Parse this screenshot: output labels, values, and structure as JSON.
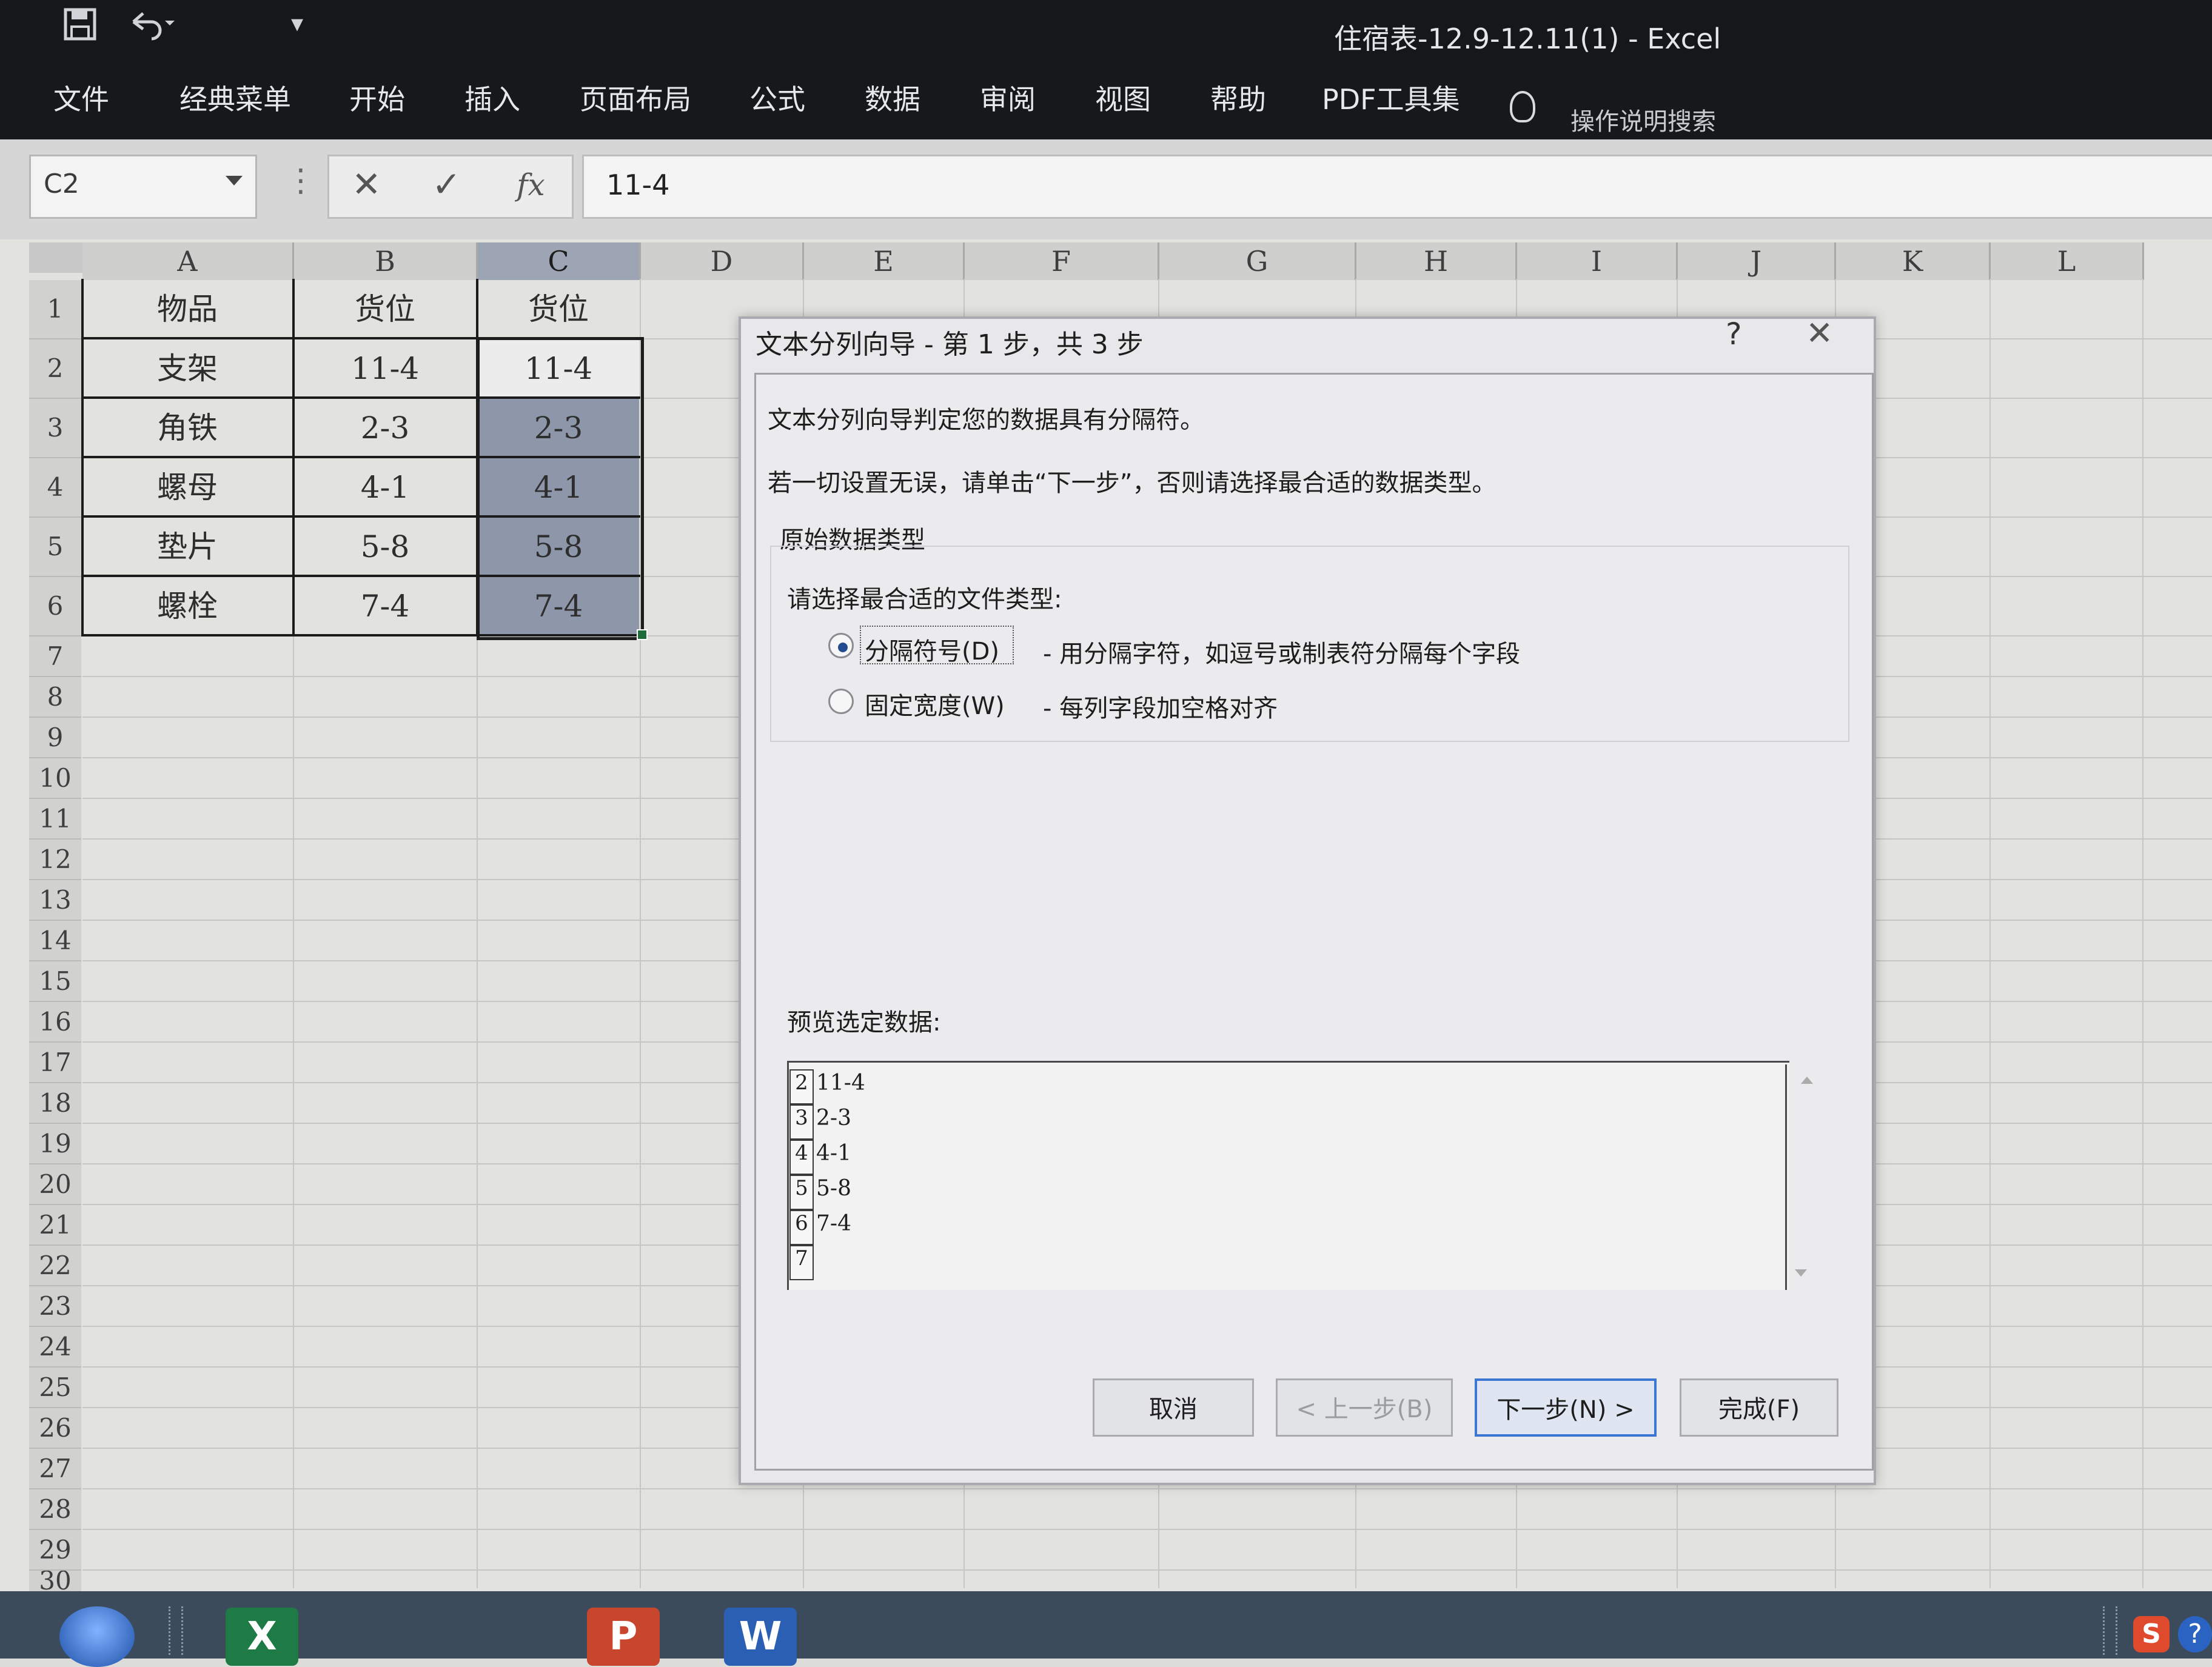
{
  "window": {
    "title": "住宿表-12.9-12.11(1)  -  Excel"
  },
  "ribbon": {
    "tabs": [
      "文件",
      "经典菜单",
      "开始",
      "插入",
      "页面布局",
      "公式",
      "数据",
      "审阅",
      "视图",
      "帮助",
      "PDF工具集"
    ],
    "tell_me": "操作说明搜索"
  },
  "formula_bar": {
    "name_box": "C2",
    "cancel_icon": "✕",
    "enter_icon": "✓",
    "fx_label": "fx",
    "formula": "11-4"
  },
  "sheet": {
    "columns": [
      "A",
      "B",
      "C",
      "D",
      "E",
      "F",
      "G",
      "H",
      "I",
      "J",
      "K",
      "L"
    ],
    "rows": [
      "1",
      "2",
      "3",
      "4",
      "5",
      "6",
      "7",
      "8",
      "9",
      "10",
      "11",
      "12",
      "13",
      "14",
      "15",
      "16",
      "17",
      "18",
      "19",
      "20",
      "21",
      "22",
      "23",
      "24",
      "25",
      "26",
      "27",
      "28",
      "29",
      "30"
    ],
    "table": [
      [
        "物品",
        "货位",
        "货位"
      ],
      [
        "支架",
        "11-4",
        "11-4"
      ],
      [
        "角铁",
        "2-3",
        "2-3"
      ],
      [
        "螺母",
        "4-1",
        "4-1"
      ],
      [
        "垫片",
        "5-8",
        "5-8"
      ],
      [
        "螺栓",
        "7-4",
        "7-4"
      ]
    ]
  },
  "dialog": {
    "title": "文本分列向导 - 第 1 步，共 3 步",
    "help_icon": "?",
    "close_icon": "✕",
    "intro1": "文本分列向导判定您的数据具有分隔符。",
    "intro2": "若一切设置无误，请单击“下一步”，否则请选择最合适的数据类型。",
    "group_label": "原始数据类型",
    "file_type_prompt": "请选择最合适的文件类型:",
    "options": [
      {
        "label": "分隔符号(D)",
        "desc": "- 用分隔字符，如逗号或制表符分隔每个字段",
        "selected": true
      },
      {
        "label": "固定宽度(W)",
        "desc": "- 每列字段加空格对齐",
        "selected": false
      }
    ],
    "preview_label": "预览选定数据:",
    "preview": [
      {
        "n": "2",
        "v": "11-4"
      },
      {
        "n": "3",
        "v": "2-3"
      },
      {
        "n": "4",
        "v": "4-1"
      },
      {
        "n": "5",
        "v": "5-8"
      },
      {
        "n": "6",
        "v": "7-4"
      },
      {
        "n": "7",
        "v": ""
      }
    ],
    "buttons": {
      "cancel": "取消",
      "back": "< 上一步(B)",
      "next": "下一步(N) >",
      "finish": "完成(F)"
    }
  },
  "taskbar": {
    "apps": [
      "Excel",
      "PowerPoint",
      "Word"
    ],
    "excel_letter": "X",
    "ppt_letter": "P",
    "word_letter": "W",
    "tray_s": "S",
    "tray_help": "?"
  },
  "colors": {
    "selection": "#8e97aa",
    "default_button_border": "#3a76d2",
    "ribbon_bg": "#161819"
  }
}
